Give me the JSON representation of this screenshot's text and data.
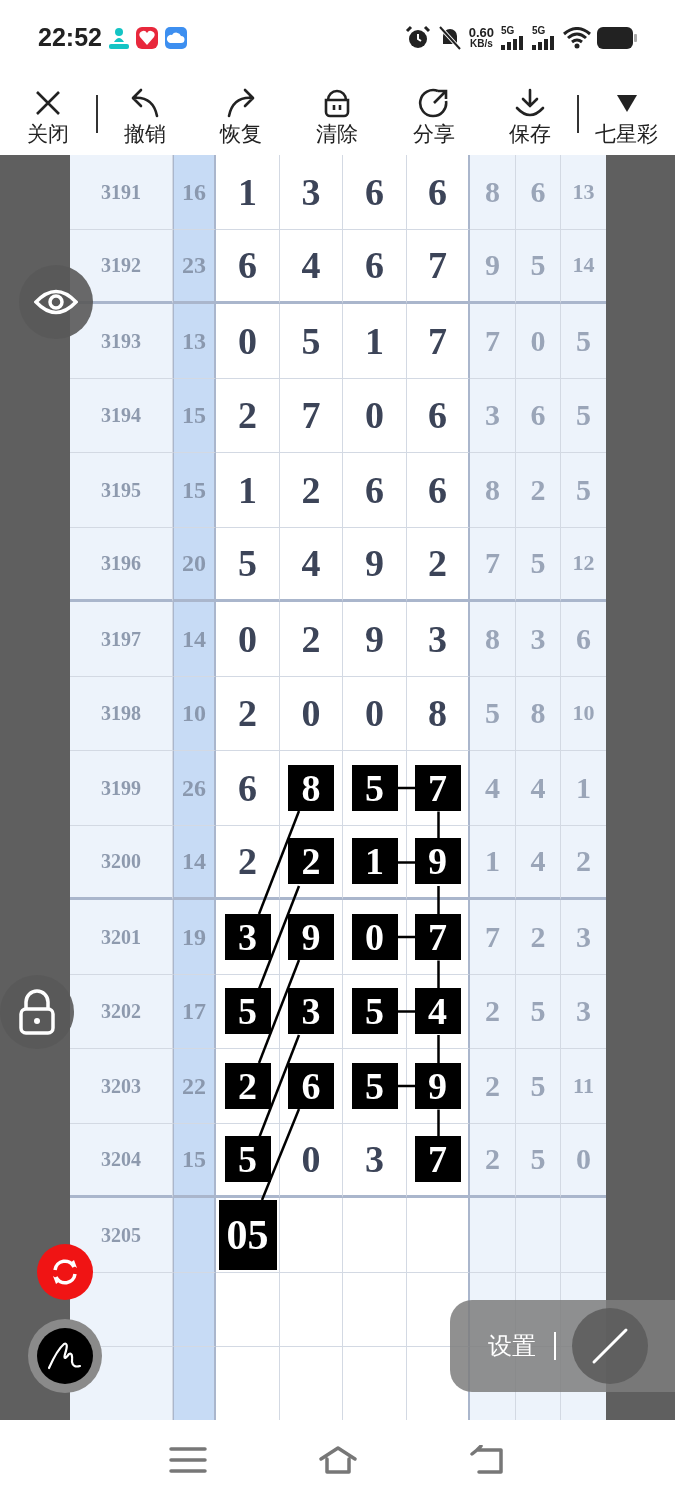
{
  "status_bar": {
    "time": "22:52",
    "net_speed": "0.60",
    "net_unit": "KB/s",
    "signals": [
      "5G",
      "5G"
    ]
  },
  "toolbar": {
    "items": [
      {
        "label": "关闭"
      },
      {
        "label": "撤销"
      },
      {
        "label": "恢复"
      },
      {
        "label": "清除"
      },
      {
        "label": "分享"
      },
      {
        "label": "保存"
      },
      {
        "label": "七星彩"
      }
    ]
  },
  "chart": {
    "groups": [
      {
        "rows": [
          {
            "issue": "3191",
            "sum": "16",
            "digits": [
              {
                "value": "1",
                "marked": false
              },
              {
                "value": "3",
                "marked": false
              },
              {
                "value": "6",
                "marked": false
              },
              {
                "value": "6",
                "marked": false
              }
            ],
            "extras": [
              "8",
              "6",
              "13"
            ]
          },
          {
            "issue": "3192",
            "sum": "23",
            "digits": [
              {
                "value": "6",
                "marked": false
              },
              {
                "value": "4",
                "marked": false
              },
              {
                "value": "6",
                "marked": false
              },
              {
                "value": "7",
                "marked": false
              }
            ],
            "extras": [
              "9",
              "5",
              "14"
            ]
          }
        ]
      },
      {
        "rows": [
          {
            "issue": "3193",
            "sum": "13",
            "digits": [
              {
                "value": "0",
                "marked": false
              },
              {
                "value": "5",
                "marked": false
              },
              {
                "value": "1",
                "marked": false
              },
              {
                "value": "7",
                "marked": false
              }
            ],
            "extras": [
              "7",
              "0",
              "5"
            ]
          },
          {
            "issue": "3194",
            "sum": "15",
            "digits": [
              {
                "value": "2",
                "marked": false
              },
              {
                "value": "7",
                "marked": false
              },
              {
                "value": "0",
                "marked": false
              },
              {
                "value": "6",
                "marked": false
              }
            ],
            "extras": [
              "3",
              "6",
              "5"
            ]
          },
          {
            "issue": "3195",
            "sum": "15",
            "digits": [
              {
                "value": "1",
                "marked": false
              },
              {
                "value": "2",
                "marked": false
              },
              {
                "value": "6",
                "marked": false
              },
              {
                "value": "6",
                "marked": false
              }
            ],
            "extras": [
              "8",
              "2",
              "5"
            ]
          },
          {
            "issue": "3196",
            "sum": "20",
            "digits": [
              {
                "value": "5",
                "marked": false
              },
              {
                "value": "4",
                "marked": false
              },
              {
                "value": "9",
                "marked": false
              },
              {
                "value": "2",
                "marked": false
              }
            ],
            "extras": [
              "7",
              "5",
              "12"
            ]
          }
        ]
      },
      {
        "rows": [
          {
            "issue": "3197",
            "sum": "14",
            "digits": [
              {
                "value": "0",
                "marked": false
              },
              {
                "value": "2",
                "marked": false
              },
              {
                "value": "9",
                "marked": false
              },
              {
                "value": "3",
                "marked": false
              }
            ],
            "extras": [
              "8",
              "3",
              "6"
            ]
          },
          {
            "issue": "3198",
            "sum": "10",
            "digits": [
              {
                "value": "2",
                "marked": false
              },
              {
                "value": "0",
                "marked": false
              },
              {
                "value": "0",
                "marked": false
              },
              {
                "value": "8",
                "marked": false
              }
            ],
            "extras": [
              "5",
              "8",
              "10"
            ]
          },
          {
            "issue": "3199",
            "sum": "26",
            "digits": [
              {
                "value": "6",
                "marked": false
              },
              {
                "value": "8",
                "marked": true
              },
              {
                "value": "5",
                "marked": true
              },
              {
                "value": "7",
                "marked": true
              }
            ],
            "extras": [
              "4",
              "4",
              "1"
            ]
          },
          {
            "issue": "3200",
            "sum": "14",
            "digits": [
              {
                "value": "2",
                "marked": false
              },
              {
                "value": "2",
                "marked": true
              },
              {
                "value": "1",
                "marked": true
              },
              {
                "value": "9",
                "marked": true
              }
            ],
            "extras": [
              "1",
              "4",
              "2"
            ]
          }
        ]
      },
      {
        "rows": [
          {
            "issue": "3201",
            "sum": "19",
            "digits": [
              {
                "value": "3",
                "marked": true
              },
              {
                "value": "9",
                "marked": true
              },
              {
                "value": "0",
                "marked": true
              },
              {
                "value": "7",
                "marked": true
              }
            ],
            "extras": [
              "7",
              "2",
              "3"
            ]
          },
          {
            "issue": "3202",
            "sum": "17",
            "digits": [
              {
                "value": "5",
                "marked": true
              },
              {
                "value": "3",
                "marked": true
              },
              {
                "value": "5",
                "marked": true
              },
              {
                "value": "4",
                "marked": true
              }
            ],
            "extras": [
              "2",
              "5",
              "3"
            ]
          },
          {
            "issue": "3203",
            "sum": "22",
            "digits": [
              {
                "value": "2",
                "marked": true
              },
              {
                "value": "6",
                "marked": true
              },
              {
                "value": "5",
                "marked": true
              },
              {
                "value": "9",
                "marked": true
              }
            ],
            "extras": [
              "2",
              "5",
              "11"
            ]
          },
          {
            "issue": "3204",
            "sum": "15",
            "digits": [
              {
                "value": "5",
                "marked": true
              },
              {
                "value": "0",
                "marked": false
              },
              {
                "value": "3",
                "marked": false
              },
              {
                "value": "7",
                "marked": true
              }
            ],
            "extras": [
              "2",
              "5",
              "0"
            ]
          }
        ]
      },
      {
        "rows": [
          {
            "issue": "3205",
            "digits": [
              {
                "value": "05",
                "marked": true
              }
            ]
          }
        ]
      }
    ]
  },
  "settings_panel": {
    "label": "设置"
  }
}
